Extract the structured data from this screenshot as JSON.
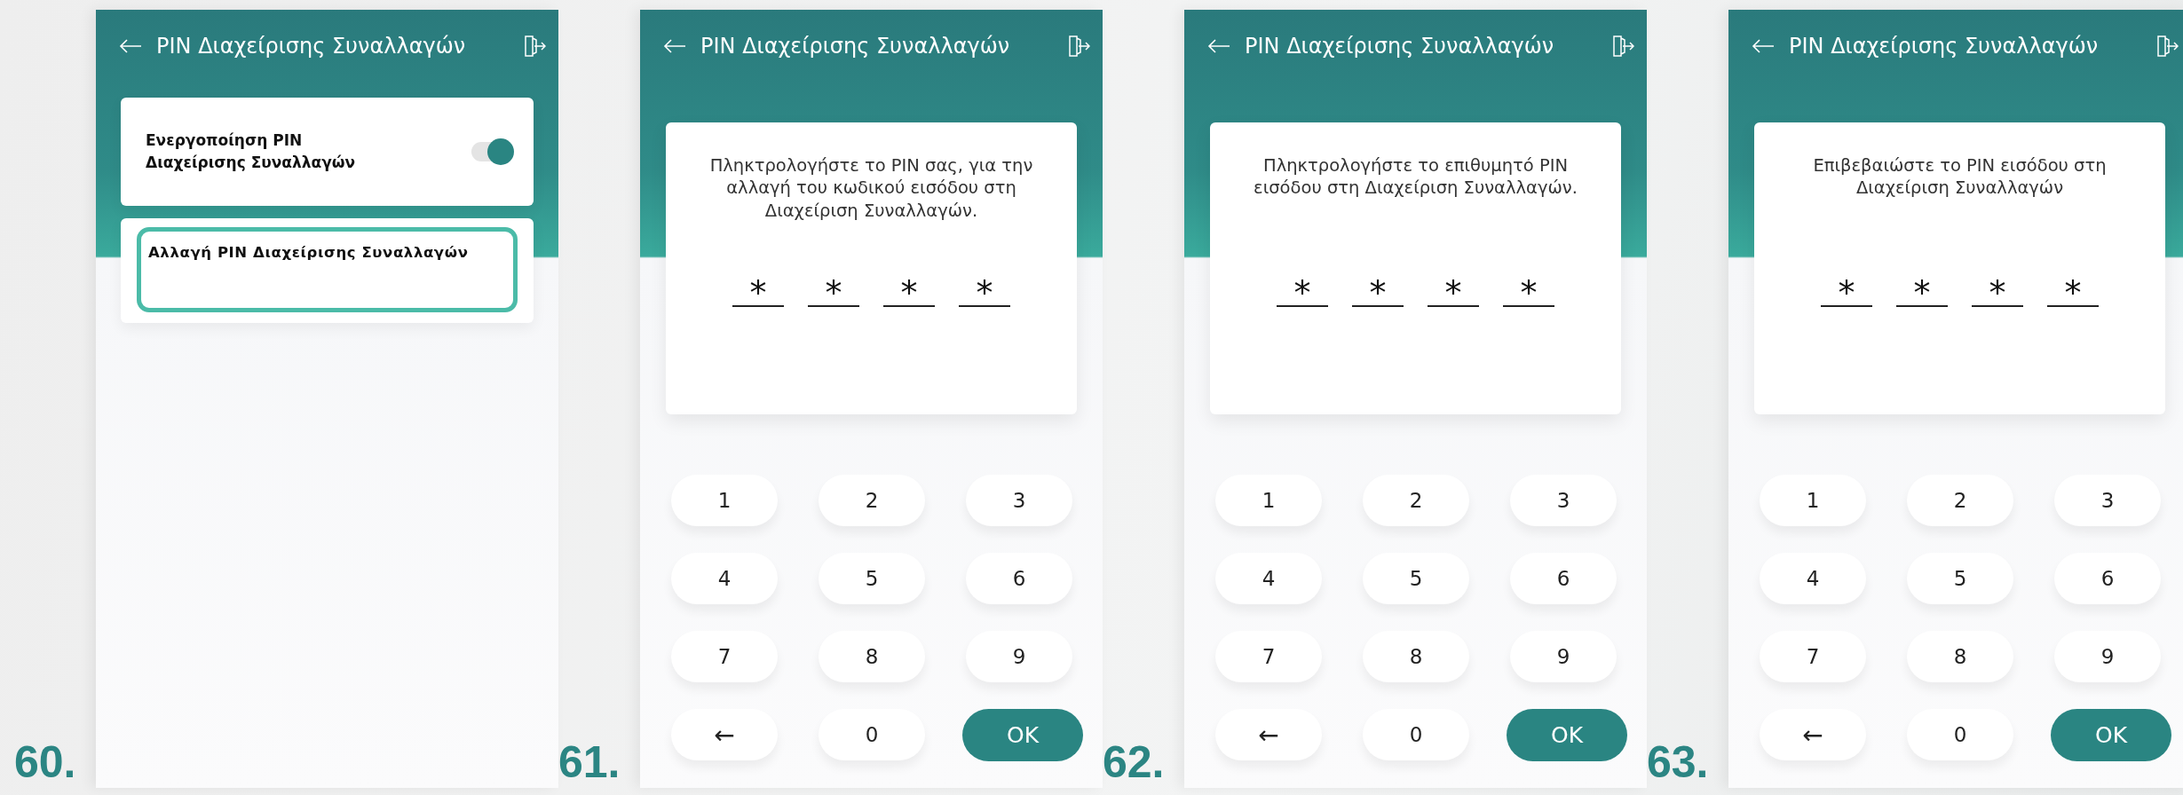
{
  "steps": [
    {
      "number": "60.",
      "kind": "settings",
      "title": "PIN Διαχείρισης Συναλλαγών",
      "settings": [
        {
          "kind": "toggle",
          "label": "Ενεργοποίηση PIN Διαχείρισης Συναλλαγών",
          "on": true
        },
        {
          "kind": "link",
          "label": "Αλλαγή PIN Διαχείρισης Συναλλαγών",
          "highlighted": true
        }
      ]
    },
    {
      "number": "61.",
      "kind": "pin",
      "title": "PIN Διαχείρισης Συναλλαγών",
      "prompt": "Πληκτρολογήστε το PIN σας, για την αλλαγή του κωδικού εισόδου στη Διαχείριση Συναλλαγών.",
      "pin_digits": [
        "*",
        "*",
        "*",
        "*"
      ],
      "keypad": [
        {
          "kind": "digit",
          "label": "1"
        },
        {
          "kind": "digit",
          "label": "2"
        },
        {
          "kind": "digit",
          "label": "3"
        },
        {
          "kind": "digit",
          "label": "4"
        },
        {
          "kind": "digit",
          "label": "5"
        },
        {
          "kind": "digit",
          "label": "6"
        },
        {
          "kind": "digit",
          "label": "7"
        },
        {
          "kind": "digit",
          "label": "8"
        },
        {
          "kind": "digit",
          "label": "9"
        },
        {
          "kind": "back",
          "label": "←"
        },
        {
          "kind": "digit",
          "label": "0"
        },
        {
          "kind": "ok",
          "label": "OK"
        }
      ]
    },
    {
      "number": "62.",
      "kind": "pin",
      "title": "PIN Διαχείρισης Συναλλαγών",
      "prompt": "Πληκτρολογήστε το επιθυμητό PIN εισόδου στη Διαχείριση Συναλλαγών.",
      "pin_digits": [
        "*",
        "*",
        "*",
        "*"
      ],
      "keypad": [
        {
          "kind": "digit",
          "label": "1"
        },
        {
          "kind": "digit",
          "label": "2"
        },
        {
          "kind": "digit",
          "label": "3"
        },
        {
          "kind": "digit",
          "label": "4"
        },
        {
          "kind": "digit",
          "label": "5"
        },
        {
          "kind": "digit",
          "label": "6"
        },
        {
          "kind": "digit",
          "label": "7"
        },
        {
          "kind": "digit",
          "label": "8"
        },
        {
          "kind": "digit",
          "label": "9"
        },
        {
          "kind": "back",
          "label": "←"
        },
        {
          "kind": "digit",
          "label": "0"
        },
        {
          "kind": "ok",
          "label": "OK"
        }
      ]
    },
    {
      "number": "63.",
      "kind": "pin",
      "title": "PIN Διαχείρισης Συναλλαγών",
      "prompt": "Επιβεβαιώστε το PIN εισόδου στη Διαχείριση Συναλλαγών",
      "pin_digits": [
        "*",
        "*",
        "*",
        "*"
      ],
      "keypad": [
        {
          "kind": "digit",
          "label": "1"
        },
        {
          "kind": "digit",
          "label": "2"
        },
        {
          "kind": "digit",
          "label": "3"
        },
        {
          "kind": "digit",
          "label": "4"
        },
        {
          "kind": "digit",
          "label": "5"
        },
        {
          "kind": "digit",
          "label": "6"
        },
        {
          "kind": "digit",
          "label": "7"
        },
        {
          "kind": "digit",
          "label": "8"
        },
        {
          "kind": "digit",
          "label": "9"
        },
        {
          "kind": "back",
          "label": "←"
        },
        {
          "kind": "digit",
          "label": "0"
        },
        {
          "kind": "ok",
          "label": "OK"
        }
      ]
    }
  ]
}
